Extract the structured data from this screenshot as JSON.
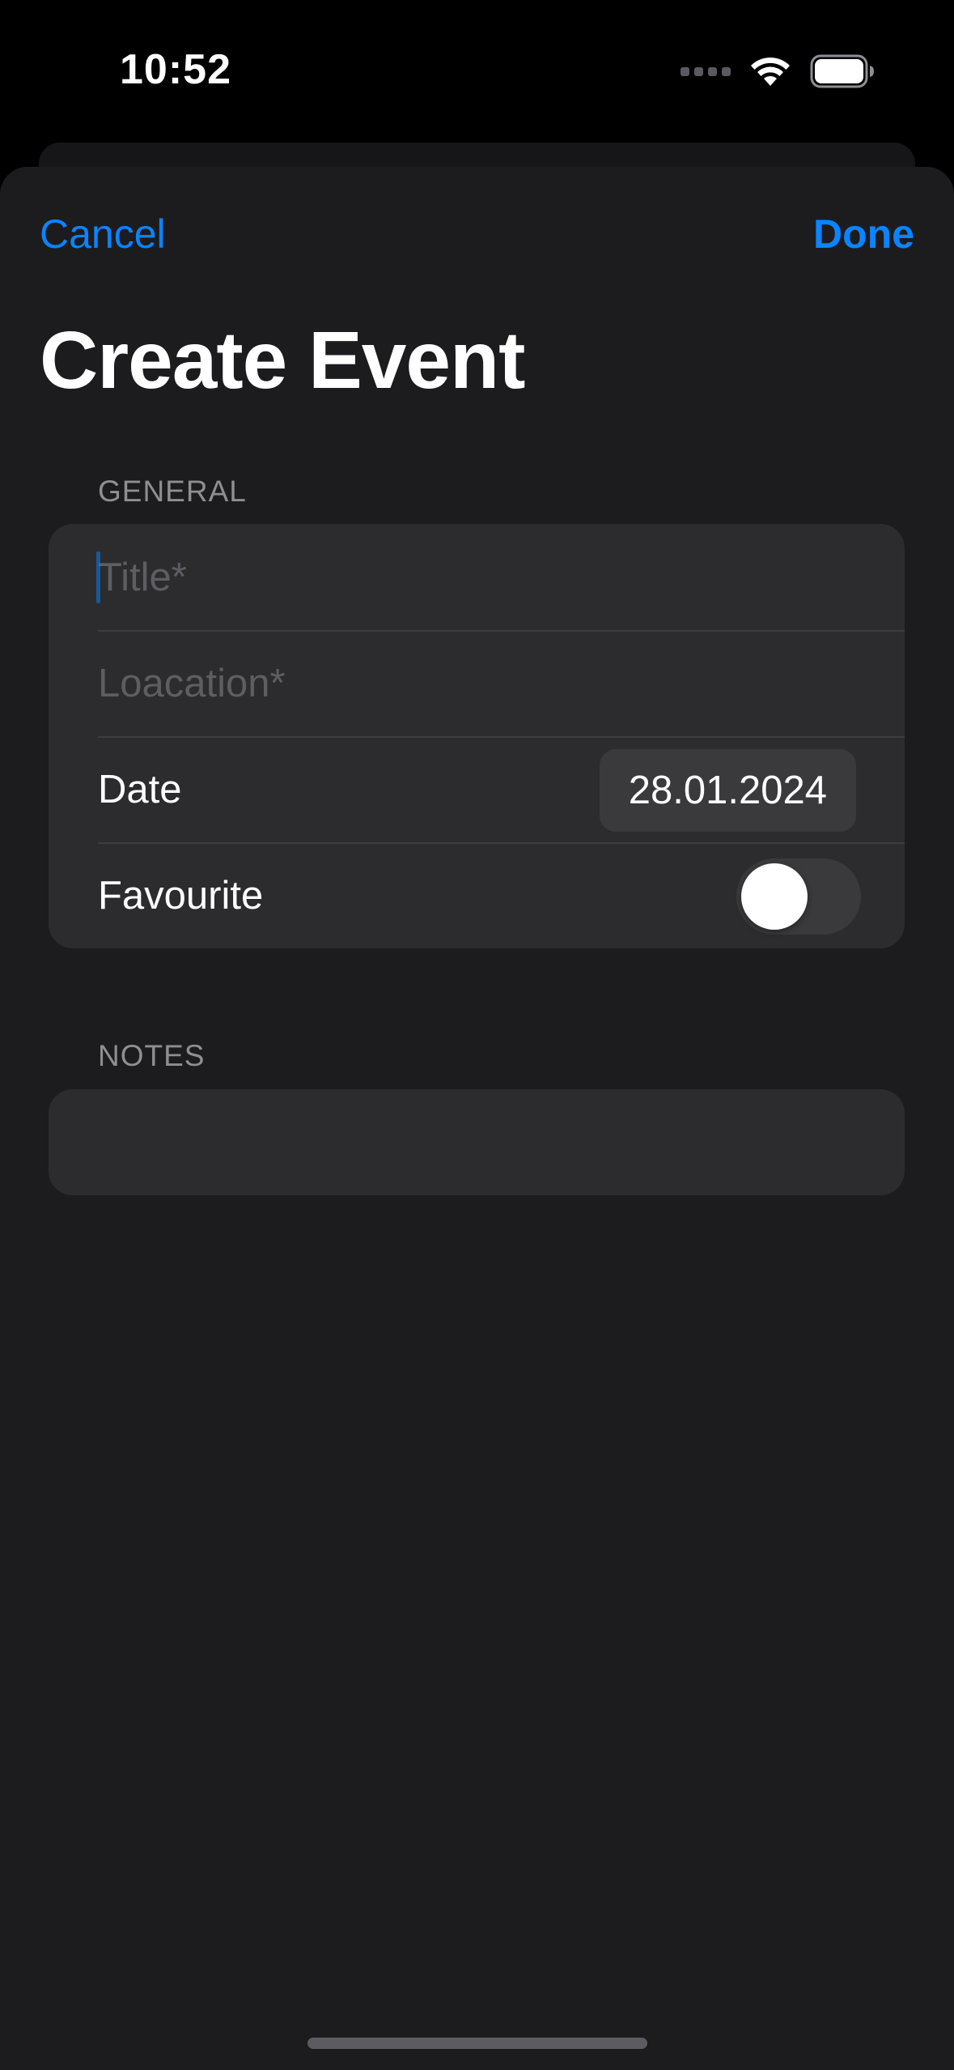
{
  "status_bar": {
    "time": "10:52"
  },
  "nav": {
    "cancel_label": "Cancel",
    "done_label": "Done"
  },
  "title": "Create Event",
  "general": {
    "header": "GENERAL",
    "title_placeholder": "Title*",
    "title_value": "",
    "location_placeholder": "Loacation*",
    "location_value": "",
    "date_label": "Date",
    "date_value": "28.01.2024",
    "favourite_label": "Favourite",
    "favourite_on": false
  },
  "notes": {
    "header": "NOTES",
    "value": ""
  },
  "colors": {
    "accent": "#0a84ff",
    "background": "#1c1c1e",
    "card": "#2c2c2e",
    "secondary_text": "#8e8e93"
  },
  "icons": [
    "cellular-signal-icon",
    "wifi-icon",
    "battery-icon"
  ]
}
